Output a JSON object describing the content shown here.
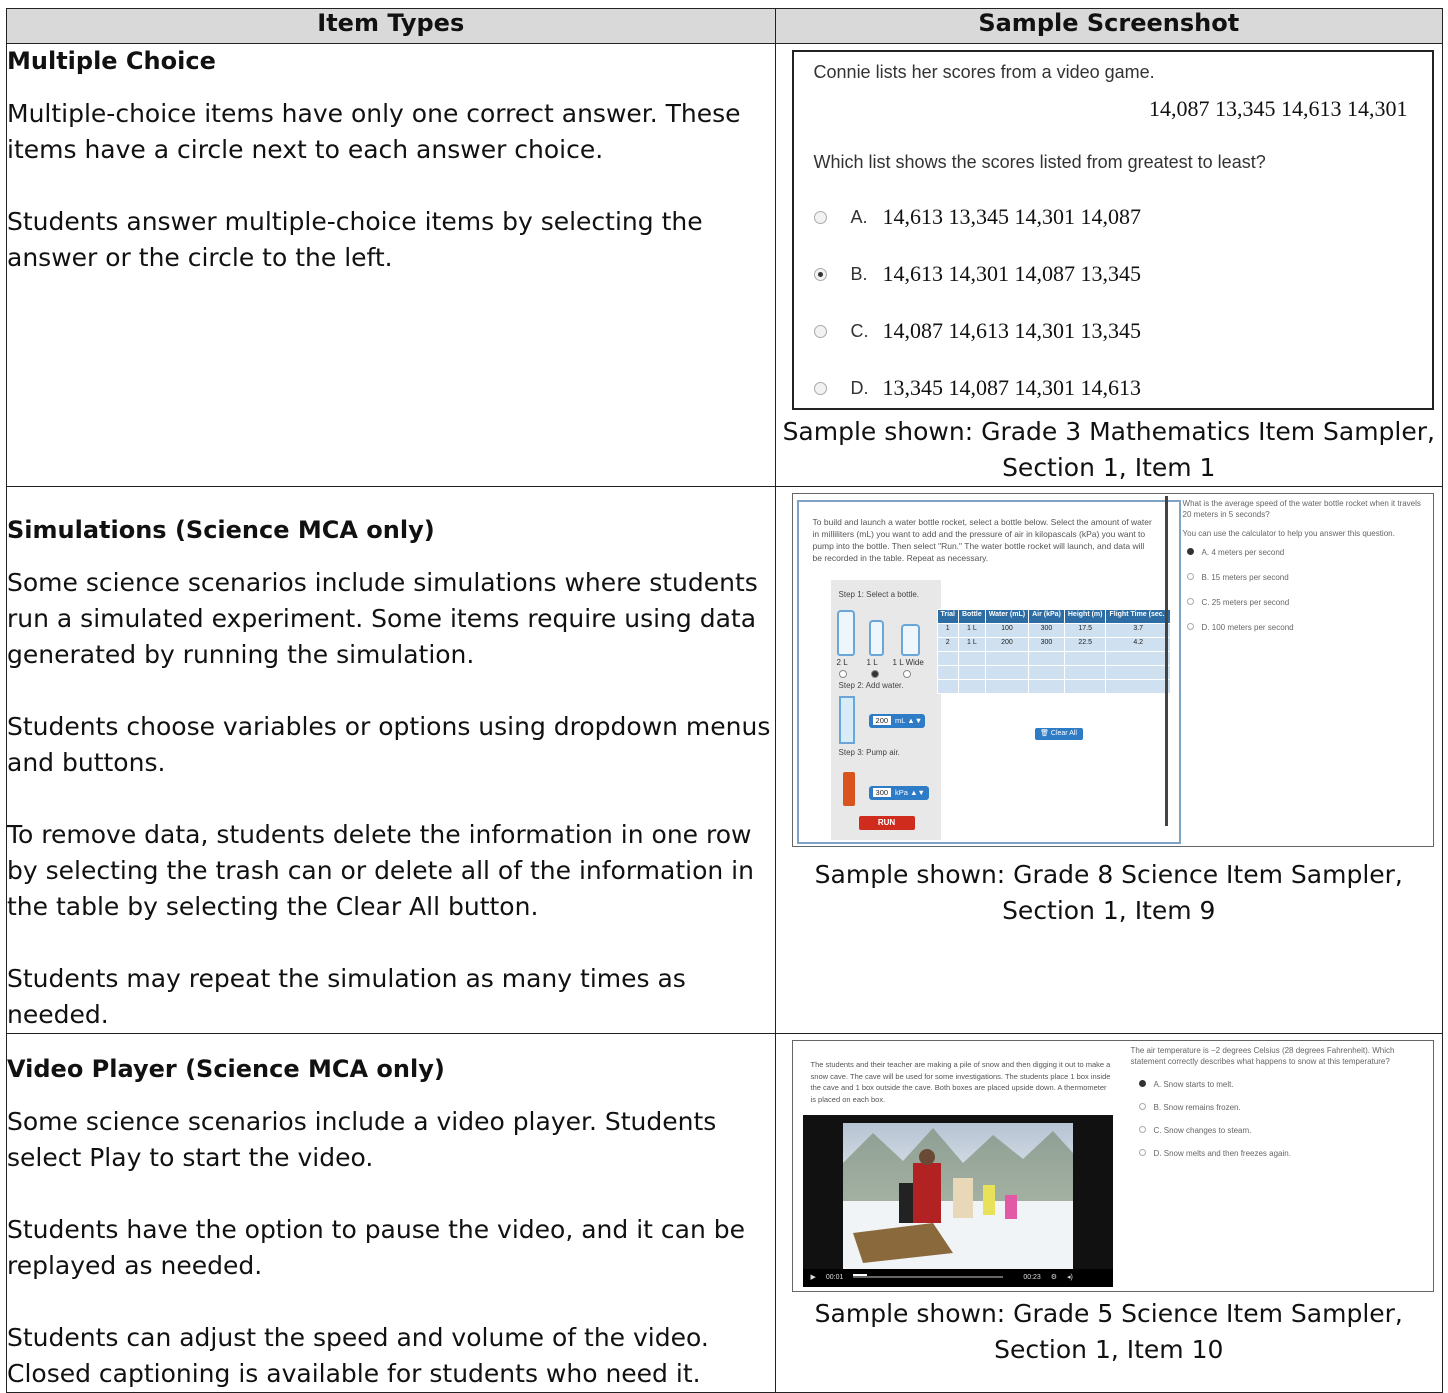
{
  "table": {
    "header_left": "Item Types",
    "header_right": "Sample Screenshot"
  },
  "row1": {
    "title": "Multiple Choice",
    "p1": "Multiple-choice items have only one correct answer. These items have a circle next to each answer choice.",
    "p2": "Students answer multiple-choice items by selecting the answer or the circle to the left.",
    "caption_line1": "Sample shown: Grade 3 Mathematics Item Sampler,",
    "caption_line2": "Section 1, Item 1",
    "sample": {
      "stem": "Connie lists her scores from a video game.",
      "numbers": "14,087  13,345  14,613  14,301",
      "question": "Which list shows the scores listed from greatest to least?",
      "options": [
        {
          "letter": "A.",
          "value": "14,613  13,345  14,301  14,087",
          "selected": false
        },
        {
          "letter": "B.",
          "value": "14,613  14,301  14,087  13,345",
          "selected": true
        },
        {
          "letter": "C.",
          "value": "14,087  14,613  14,301  13,345",
          "selected": false
        },
        {
          "letter": "D.",
          "value": "13,345  14,087  14,301  14,613",
          "selected": false
        }
      ]
    }
  },
  "row2": {
    "title": "Simulations (Science MCA only)",
    "p1": "Some science scenarios include simulations where students run a simulated experiment. Some items require using data generated by running the simulation.",
    "p2": "Students choose variables or options using dropdown menus and buttons.",
    "p3": "To remove data, students delete the information in one row by selecting the trash can or delete all of the information in the table by selecting the Clear All button.",
    "p4": "Students may repeat the simulation as many times as needed.",
    "caption_line1": "Sample shown: Grade 8 Science Item Sampler,",
    "caption_line2": "Section 1, Item 9",
    "sample": {
      "intro": "To build and launch a water bottle rocket, select a bottle below. Select the amount of water in milliliters (mL) you want to add and the pressure of air in kilopascals (kPa) you want to pump into the bottle. Then select \"Run.\" The water bottle rocket will launch, and data will be recorded in the table. Repeat as necessary.",
      "step1": "Step 1: Select a bottle.",
      "bottle_labels": [
        "2 L",
        "1 L",
        "1 L Wide"
      ],
      "step2": "Step 2: Add water.",
      "water_value": "200",
      "water_unit": "mL",
      "step3": "Step 3: Pump air.",
      "air_value": "300",
      "air_unit": "kPa",
      "run": "RUN",
      "table_headers": [
        "Trial",
        "Bottle",
        "Water (mL)",
        "Air (kPa)",
        "Height (m)",
        "Flight Time (sec.)"
      ],
      "table_rows": [
        [
          "1",
          "1 L",
          "100",
          "300",
          "17.5",
          "3.7"
        ],
        [
          "2",
          "1 L",
          "200",
          "300",
          "22.5",
          "4.2"
        ]
      ],
      "clear_all": "Clear All",
      "question": "What is the average speed of the water bottle rocket when it travels 20 meters in 5 seconds?",
      "calc_note": "You can use the calculator to help you answer this question.",
      "options": [
        {
          "letter": "A.",
          "text": "4 meters per second",
          "selected": true
        },
        {
          "letter": "B.",
          "text": "15 meters per second",
          "selected": false
        },
        {
          "letter": "C.",
          "text": "25 meters per second",
          "selected": false
        },
        {
          "letter": "D.",
          "text": "100 meters per second",
          "selected": false
        }
      ]
    }
  },
  "row3": {
    "title": "Video Player (Science MCA only)",
    "p1": "Some science scenarios include a video player. Students select Play to start the video.",
    "p2": "Students have the option to pause the video, and it can be replayed as needed.",
    "p3": "Students can adjust the speed and volume of the video. Closed captioning is available for students who need it.",
    "caption_line1": "Sample shown: Grade 5 Science Item Sampler,",
    "caption_line2": "Section 1, Item 10",
    "sample": {
      "intro": "The students and their teacher are making a pile of snow and then digging it out to make a snow cave. The cave will be used for some investigations. The students place 1 box inside the cave and 1 box outside the cave. Both boxes are placed upside down. A thermometer is placed on each box.",
      "time_elapsed": "00:01",
      "time_total": "00:23",
      "question": "The air temperature is −2 degrees Celsius (28 degrees Fahrenheit). Which statement correctly describes what happens to snow at this temperature?",
      "options": [
        {
          "letter": "A.",
          "text": "Snow starts to melt.",
          "selected": true
        },
        {
          "letter": "B.",
          "text": "Snow remains frozen.",
          "selected": false
        },
        {
          "letter": "C.",
          "text": "Snow changes to steam.",
          "selected": false
        },
        {
          "letter": "D.",
          "text": "Snow melts and then freezes again.",
          "selected": false
        }
      ]
    }
  },
  "colors": {
    "header_bg": "#d9d9d9",
    "border": "#222222",
    "sim_blue": "#2e7bc6",
    "run_red": "#d02c1e"
  }
}
